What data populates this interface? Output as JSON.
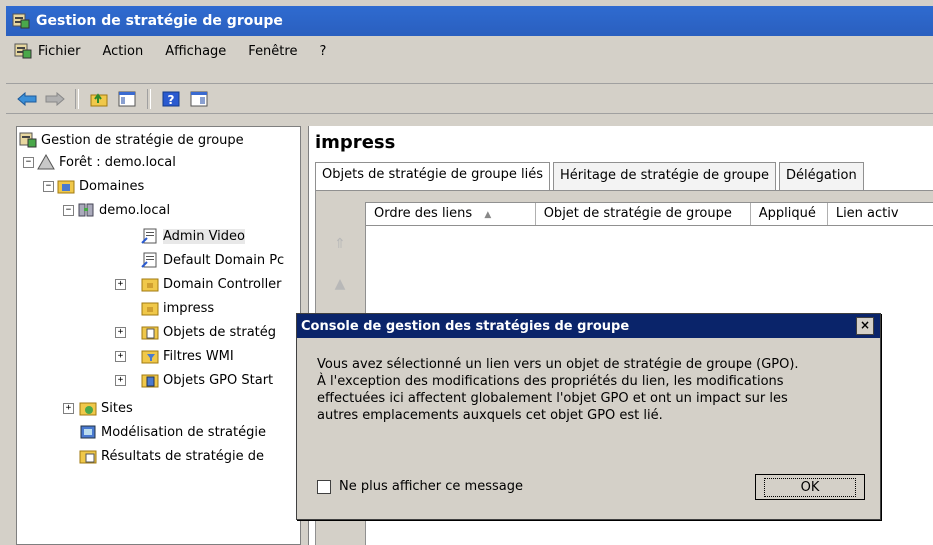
{
  "window": {
    "title": "Gestion de stratégie de groupe"
  },
  "menu": [
    "Fichier",
    "Action",
    "Affichage",
    "Fenêtre",
    "?"
  ],
  "toolbar": {
    "icons": [
      "back-arrow-icon",
      "forward-arrow-icon",
      "up-folder-icon",
      "show-hide-tree-icon",
      "help-icon",
      "properties-icon"
    ]
  },
  "tree": {
    "items": [
      {
        "label": "Gestion de stratégie de groupe"
      },
      {
        "label": "Forêt : demo.local",
        "toggle": "−"
      },
      {
        "label": "Domaines",
        "toggle": "−"
      },
      {
        "label": "demo.local",
        "toggle": "−"
      },
      {
        "label": "Admin Video"
      },
      {
        "label": "Default Domain Pc"
      },
      {
        "label": "Domain Controller",
        "toggle": "+"
      },
      {
        "label": "impress"
      },
      {
        "label": "Objets de stratég",
        "toggle": "+"
      },
      {
        "label": "Filtres WMI",
        "toggle": "+"
      },
      {
        "label": "Objets GPO Start",
        "toggle": "+"
      },
      {
        "label": "Sites",
        "toggle": "+"
      },
      {
        "label": "Modélisation de stratégie"
      },
      {
        "label": "Résultats de stratégie de"
      }
    ]
  },
  "content": {
    "title": "impress",
    "tabs": [
      "Objets de stratégie de groupe liés",
      "Héritage de stratégie de groupe",
      "Délégation"
    ],
    "columns": [
      "Ordre des liens",
      "Objet de stratégie de groupe",
      "Appliqué",
      "Lien activ"
    ]
  },
  "dialog": {
    "title": "Console de gestion des stratégies de groupe",
    "lines": [
      "Vous avez sélectionné un lien vers un objet de stratégie de groupe (GPO).",
      "À l'exception des modifications des propriétés du lien, les modifications",
      "effectuées ici affectent globalement l'objet GPO et ont un impact sur les",
      "autres emplacements auxquels cet objet GPO est lié."
    ],
    "checkbox_label": "Ne plus afficher ce message",
    "ok_label": "OK",
    "close_label": "×"
  }
}
